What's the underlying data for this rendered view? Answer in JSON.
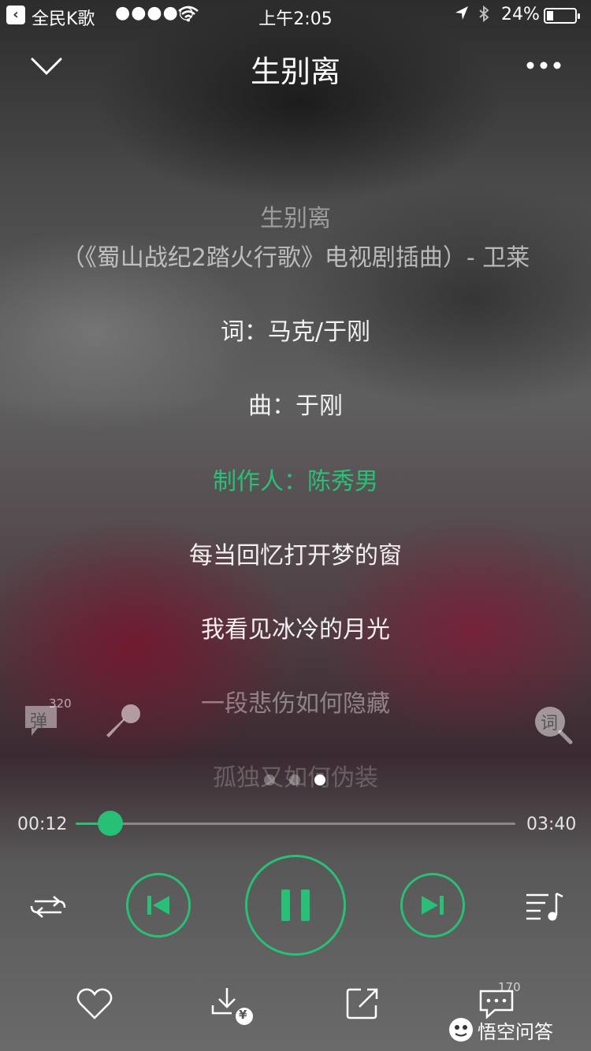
{
  "status_bar": {
    "carrier": "全民K歌",
    "signal": "●●●●○",
    "time": "上午2:05",
    "battery": "24%",
    "battery_level": 0.24
  },
  "header": {
    "title": "生别离"
  },
  "lyrics": [
    {
      "text": "生别离",
      "style": "dim"
    },
    {
      "text": "（《蜀山战纪2踏火行歌》电视剧插曲）- 卫莱",
      "style": "med"
    },
    {
      "text": "词：马克/于刚",
      "style": "white"
    },
    {
      "text": "曲：于刚",
      "style": "white"
    },
    {
      "text": "制作人：陈秀男",
      "style": "green"
    },
    {
      "text": "每当回忆打开梦的窗",
      "style": "white"
    },
    {
      "text": "我看见冰冷的月光",
      "style": "white"
    },
    {
      "text": "一段悲伤如何隐藏",
      "style": "fade"
    },
    {
      "text": "孤独又如何伪装",
      "style": "fade2"
    }
  ],
  "side_controls": {
    "danmu_label": "弹",
    "danmu_count": "320",
    "lyric_label": "词"
  },
  "pager": {
    "count": 3,
    "active": 2
  },
  "player": {
    "current_time": "00:12",
    "total_time": "03:40",
    "progress": 0.078
  },
  "bottom_bar": {
    "comment_count": "170",
    "download_badge": "¥"
  },
  "watermark": {
    "text": "悟空问答"
  },
  "colors": {
    "accent": "#28c076"
  }
}
